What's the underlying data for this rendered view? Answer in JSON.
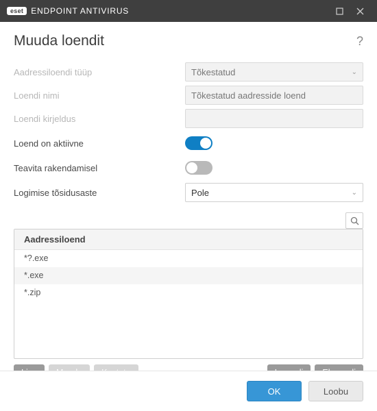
{
  "titlebar": {
    "brand_badge": "eset",
    "brand_text": "ENDPOINT ANTIVIRUS"
  },
  "header": {
    "title": "Muuda loendit"
  },
  "fields": {
    "type_label": "Aadressiloendi tüüp",
    "type_value": "Tõkestatud",
    "name_label": "Loendi nimi",
    "name_value": "Tõkestatud aadresside loend",
    "desc_label": "Loendi kirjeldus",
    "desc_value": "",
    "active_label": "Loend on aktiivne",
    "active_on": true,
    "notify_label": "Teavita rakendamisel",
    "notify_on": false,
    "severity_label": "Logimise tõsidusaste",
    "severity_value": "Pole"
  },
  "list": {
    "header": "Aadressiloend",
    "items": [
      "*?.exe",
      "*.exe",
      "*.zip"
    ]
  },
  "actions": {
    "add": "Lisa",
    "edit": "Muuda",
    "delete": "Kustuta",
    "import": "Impordi",
    "export": "Ekspordi"
  },
  "footer": {
    "ok": "OK",
    "cancel": "Loobu"
  }
}
